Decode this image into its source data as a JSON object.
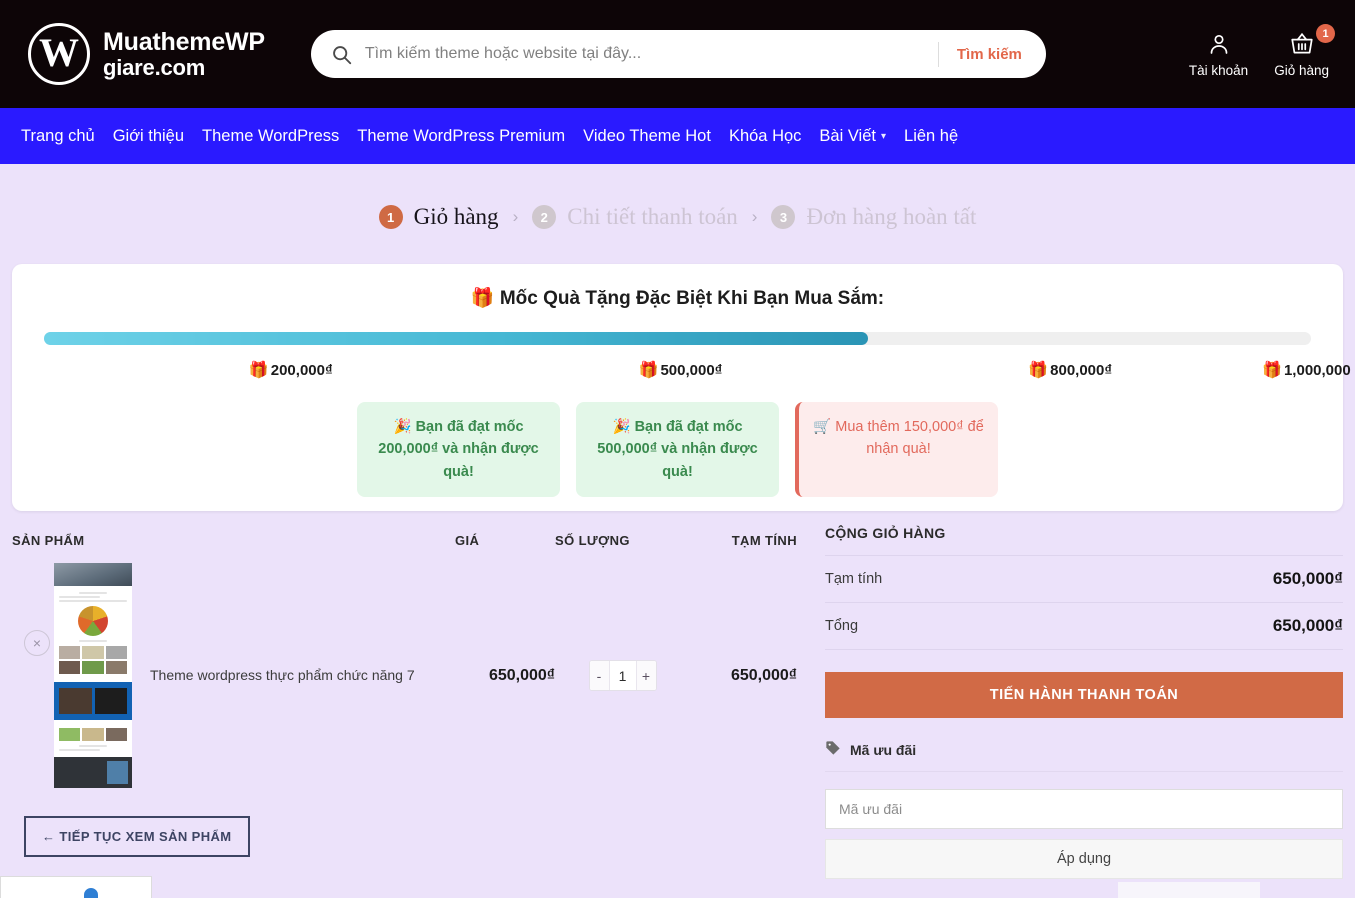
{
  "header": {
    "brand_line1": "MuathemeWP",
    "brand_line2": "giare.com",
    "logo_letter": "W",
    "search_placeholder": "Tìm kiếm theme hoặc website tại đây...",
    "search_value": "",
    "search_button": "Tìm kiếm",
    "account_label": "Tài khoản",
    "cart_label": "Giỏ hàng",
    "cart_count": "1",
    "accent_color": "#e2674a",
    "background_color": "#0d0507"
  },
  "nav": {
    "background_color": "#2a1aff",
    "items": [
      {
        "label": "Trang chủ",
        "has_caret": false
      },
      {
        "label": "Giới thiệu",
        "has_caret": false
      },
      {
        "label": "Theme WordPress",
        "has_caret": false
      },
      {
        "label": "Theme WordPress Premium",
        "has_caret": false
      },
      {
        "label": "Video Theme Hot",
        "has_caret": false
      },
      {
        "label": "Khóa Học",
        "has_caret": false
      },
      {
        "label": "Bài Viết",
        "has_caret": true
      },
      {
        "label": "Liên hệ",
        "has_caret": false
      }
    ]
  },
  "steps": {
    "separator": "›",
    "items": [
      {
        "num": "1",
        "label": "Giỏ hàng",
        "active": true
      },
      {
        "num": "2",
        "label": "Chi tiết thanh toán",
        "active": false
      },
      {
        "num": "3",
        "label": "Đơn hàng hoàn tất",
        "active": false
      }
    ]
  },
  "gift_panel": {
    "icon": "gift-icon",
    "title": "🎁 Mốc Quà Tặng Đặc Biệt Khi Bạn Mua Sắm:",
    "progress_percent": 65,
    "bar_start_color": "#6ed2e8",
    "bar_end_color": "#2a94b5",
    "milestones": [
      {
        "icon": "🎁",
        "label": "200,000₫",
        "left_percent": 17
      },
      {
        "icon": "🎁",
        "label": "500,000₫",
        "left_percent": 47
      },
      {
        "icon": "🎁",
        "label": "800,000₫",
        "left_percent": 77
      },
      {
        "icon": "🎁",
        "label": "1,000,000",
        "left_percent": 95
      }
    ],
    "messages": [
      {
        "type": "ok",
        "icon": "🎉",
        "text": "Bạn đã đạt mốc 200,000₫ và nhận được quà!"
      },
      {
        "type": "ok",
        "icon": "🎉",
        "text": "Bạn đã đạt mốc 500,000₫ và nhận được quà!"
      },
      {
        "type": "warn",
        "icon": "🛒",
        "text": "Mua thêm 150,000₫ để nhận quà!"
      }
    ]
  },
  "cart": {
    "columns": {
      "product": "SẢN PHẨM",
      "price": "GIÁ",
      "quantity": "SỐ LƯỢNG",
      "subtotal": "TẠM TÍNH"
    },
    "items": [
      {
        "remove_icon": "×",
        "name": "Theme wordpress thực phẩm chức năng 7",
        "price": "650,000₫",
        "qty_minus": "-",
        "qty_value": "1",
        "qty_plus": "+",
        "subtotal": "650,000₫"
      }
    ],
    "continue_button": "← TIẾP TỤC XEM SẢN PHẨM"
  },
  "totals": {
    "title": "CỘNG GIỎ HÀNG",
    "rows": [
      {
        "label": "Tạm tính",
        "value": "650,000₫"
      },
      {
        "label": "Tổng",
        "value": "650,000₫"
      }
    ],
    "checkout_button": "TIẾN HÀNH THANH TOÁN",
    "checkout_color": "#d16a46",
    "coupon_heading": "Mã ưu đãi",
    "coupon_placeholder": "Mã ưu đãi",
    "coupon_value": "",
    "coupon_apply": "Áp dụng"
  }
}
